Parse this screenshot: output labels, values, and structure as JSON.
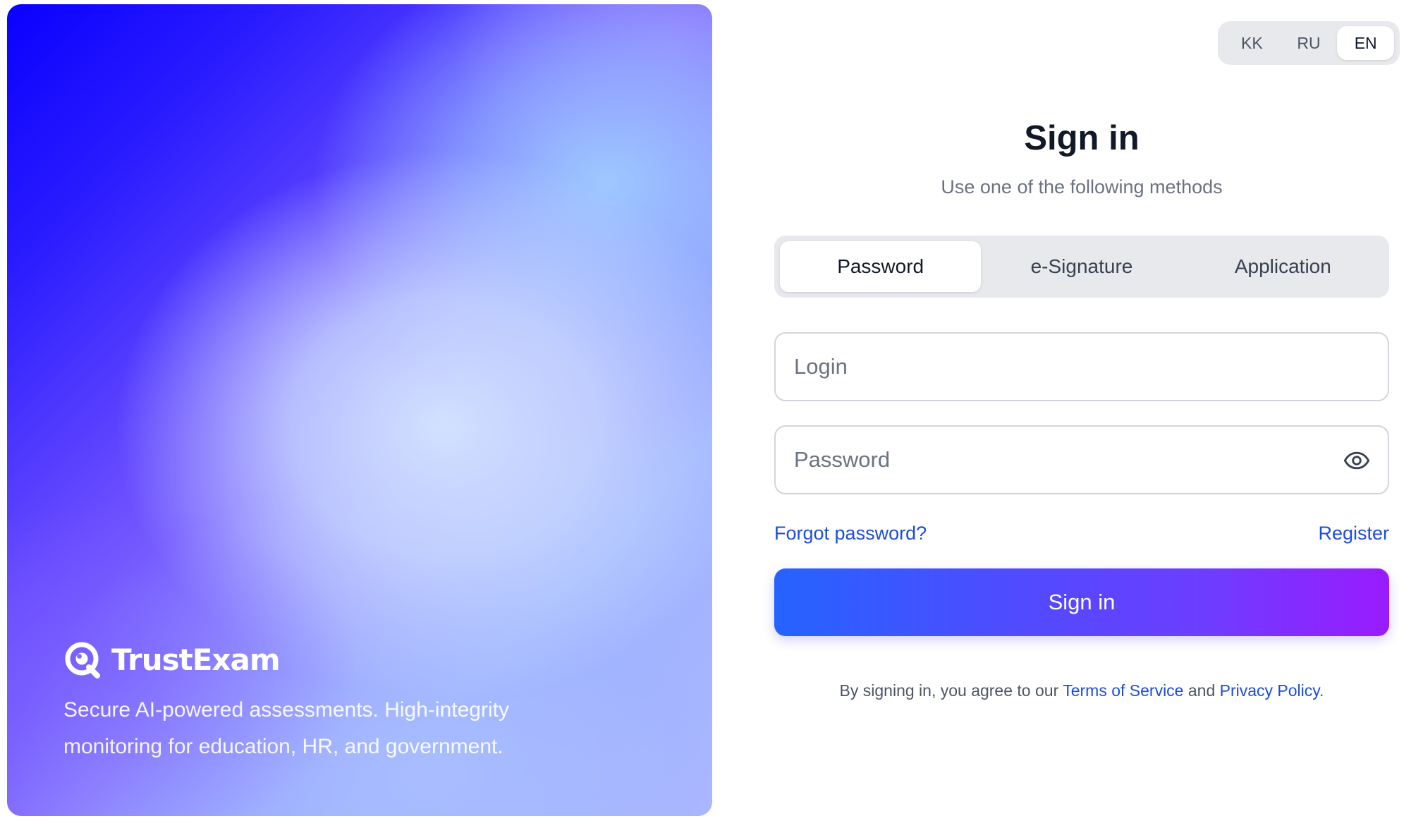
{
  "brand": {
    "name": "TrustExam",
    "tagline": "Secure AI-powered assessments. High-integrity monitoring for education, HR, and government."
  },
  "language": {
    "options": [
      "KK",
      "RU",
      "EN"
    ],
    "selected": "EN"
  },
  "signin": {
    "title": "Sign in",
    "subtitle": "Use one of the following methods",
    "tabs": [
      {
        "label": "Password",
        "active": true
      },
      {
        "label": "e-Signature",
        "active": false
      },
      {
        "label": "Application",
        "active": false
      }
    ],
    "login": {
      "placeholder": "Login",
      "value": ""
    },
    "password": {
      "placeholder": "Password",
      "value": ""
    },
    "forgot_label": "Forgot password?",
    "register_label": "Register",
    "submit_label": "Sign in",
    "legal": {
      "prefix": "By signing in, you agree to our ",
      "terms": "Terms of Service",
      "middle": " and ",
      "privacy": "Privacy Policy."
    }
  },
  "icons": {
    "logo": "trustexam-logo-icon",
    "password_visibility": "eye-icon"
  },
  "colors": {
    "primary_link": "#1d4ed8",
    "button_gradient_start": "#2563ff",
    "button_gradient_end": "#9a1bff",
    "hero_deep_blue": "#0a00ff"
  }
}
